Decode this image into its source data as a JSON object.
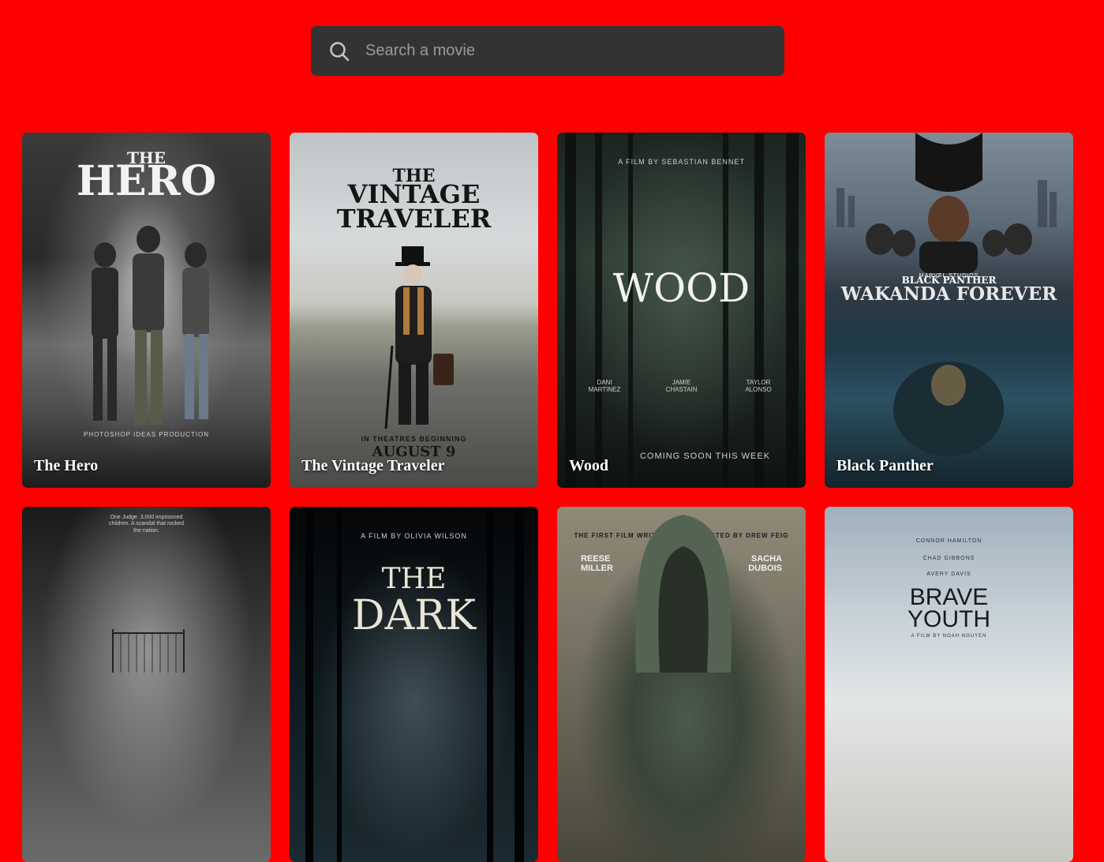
{
  "search": {
    "placeholder": "Search a movie",
    "value": ""
  },
  "movies": [
    {
      "title": "The Hero",
      "poster": {
        "line1": "THE",
        "line2": "HERO",
        "caption": "PHOTOSHOP IDEAS PRODUCTION"
      }
    },
    {
      "title": "The Vintage Traveler",
      "poster": {
        "line1": "THE",
        "line2": "VINTAGE",
        "line3": "TRAVELER",
        "caption": "IN THEATRES BEGINNING",
        "date": "AUGUST 9"
      }
    },
    {
      "title": "Wood",
      "poster": {
        "top": "A FILM BY SEBASTIAN BENNET",
        "line1": "WOOD",
        "cast": [
          "DANI MARTINEZ",
          "JAMIE CHASTAIN",
          "TAYLOR ALONSO"
        ],
        "caption": "COMING SOON THIS WEEK"
      }
    },
    {
      "title": "Black Panther",
      "poster": {
        "studio": "MARVEL STUDIOS",
        "line1": "BLACK PANTHER",
        "line2": "WAKANDA FOREVER"
      }
    },
    {
      "title": "",
      "poster": {
        "top": "One Judge. 3,000 imprisoned children. A scandal that rocked the nation."
      }
    },
    {
      "title": "",
      "poster": {
        "top": "A FILM BY OLIVIA WILSON",
        "line1": "THE",
        "line2": "DARK"
      }
    },
    {
      "title": "",
      "poster": {
        "top": "THE FIRST FILM WRITTEN AND DIRECTED BY DREW FEIG",
        "left": "REESE MILLER",
        "right": "SACHA DUBOIS"
      }
    },
    {
      "title": "",
      "poster": {
        "cast": [
          "CONNOR HAMILTON",
          "CHAD GIBBONS",
          "AVERY DAVIS"
        ],
        "line1": "BRAVE",
        "line2": "YOUTH",
        "caption": "A FILM BY NOAH NGUYEN"
      }
    }
  ],
  "colors": {
    "background": "#ff0000",
    "search_bg": "#333333"
  }
}
